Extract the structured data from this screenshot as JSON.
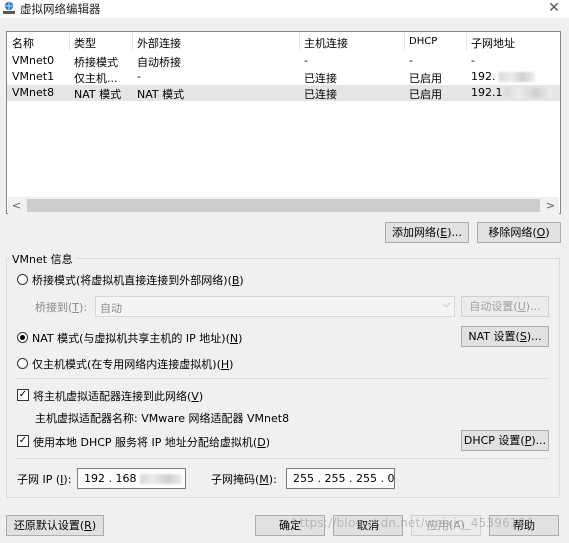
{
  "window": {
    "title": "虚拟网络编辑器",
    "close_glyph": "✕"
  },
  "table": {
    "headers": [
      "名称",
      "类型",
      "外部连接",
      "主机连接",
      "DHCP",
      "子网地址"
    ],
    "rows": [
      [
        "VMnet0",
        "桥接模式",
        "自动桥接",
        "-",
        "-",
        "-"
      ],
      [
        "VMnet1",
        "仅主机...",
        "-",
        "已连接",
        "已启用",
        "192."
      ],
      [
        "VMnet8",
        "NAT 模式",
        "NAT 模式",
        "已连接",
        "已启用",
        "192.1"
      ]
    ]
  },
  "scrollbar": {
    "left_arrow": "<",
    "right_arrow": ">"
  },
  "buttons": {
    "add_network": {
      "text": "添加网络(",
      "key": "E",
      "tail": ")..."
    },
    "remove_network": {
      "text": "移除网络(",
      "key": "O",
      "tail": ")"
    }
  },
  "vmnet_info": {
    "title": "VMnet 信息",
    "bridged_mode": {
      "text": "桥接模式(将虚拟机直接连接到外部网络)(",
      "key": "B",
      "tail": ")"
    },
    "bridged_to": {
      "text": "桥接到(",
      "key": "T",
      "tail": "):"
    },
    "bridged_to_value": "自动",
    "auto_settings": {
      "text": "自动设置(",
      "key": "U",
      "tail": ")..."
    },
    "nat_mode": {
      "text": "NAT 模式(与虚拟机共享主机的 IP 地址)(",
      "key": "N",
      "tail": ")"
    },
    "nat_settings": {
      "text": "NAT 设置(",
      "key": "S",
      "tail": ")..."
    },
    "host_only": {
      "text": "仅主机模式(在专用网络内连接虚拟机)(",
      "key": "H",
      "tail": ")"
    },
    "connect_adapter": {
      "text": "将主机虚拟适配器连接到此网络(",
      "key": "V",
      "tail": ")"
    },
    "adapter_name": "主机虚拟适配器名称: VMware 网络适配器 VMnet8",
    "use_dhcp": {
      "text": "使用本地 DHCP 服务将 IP 地址分配给虚拟机(",
      "key": "D",
      "tail": ")"
    },
    "dhcp_settings": {
      "text": "DHCP 设置(",
      "key": "P",
      "tail": ")..."
    },
    "subnet_ip": {
      "text": "子网 IP (",
      "key": "I",
      "tail": "):"
    },
    "subnet_ip_value": "192 . 168 .",
    "subnet_mask": {
      "text": "子网掩码(",
      "key": "M",
      "tail": "):"
    },
    "subnet_mask_value": "255 . 255 . 255 .  0"
  },
  "footer": {
    "restore_defaults": {
      "text": "还原默认设置(",
      "key": "R",
      "tail": ")"
    },
    "ok": "确定",
    "cancel": "取消",
    "apply": "应用(A)",
    "help": "帮助",
    "watermark": "https://blog.csdn.net/weixin_45396186"
  },
  "radio_state": {
    "bridged": false,
    "nat": true,
    "host_only": false
  },
  "check_state": {
    "connect_adapter": true,
    "use_dhcp": true
  },
  "icons": {
    "app": "network-globe-icon",
    "close": "close-icon"
  }
}
